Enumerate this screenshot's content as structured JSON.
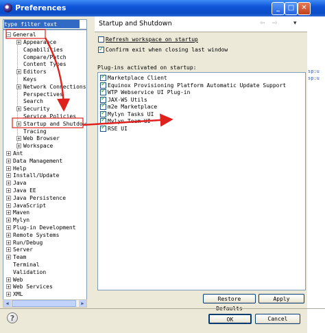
{
  "window": {
    "title": "Preferences"
  },
  "titlebar": {
    "minimize": "_",
    "maximize": "□",
    "close": "✕"
  },
  "filter": {
    "value": "type filter text"
  },
  "tree": {
    "general": {
      "label": "General",
      "children": [
        "Appearance",
        "Capabilities",
        "Compare/Patch",
        "Content Types",
        "Editors",
        "Keys",
        "Network Connections",
        "Perspectives",
        "Search",
        "Security",
        "Service Policies",
        "Startup and Shutdown",
        "Tracing",
        "Web Browser",
        "Workspace"
      ]
    },
    "roots": [
      "Ant",
      "Data Management",
      "Help",
      "Install/Update",
      "Java",
      "Java EE",
      "Java Persistence",
      "JavaScript",
      "Maven",
      "Mylyn",
      "Plug-in Development",
      "Remote Systems",
      "Run/Debug",
      "Server",
      "Team",
      "Terminal",
      "Validation",
      "Web",
      "Web Services",
      "XML"
    ]
  },
  "page": {
    "title": "Startup and Shutdown",
    "nav": {
      "back": "⇦",
      "forward": "⇨",
      "menu": "▾"
    },
    "refresh_label": "Refresh workspace on startup",
    "confirm_label": "Confirm exit when closing last window",
    "plugins_label": "Plug-ins activated on startup:",
    "plugins": [
      "Marketplace Client",
      "Equinox Provisioning Platform Automatic Update Support",
      "WTP Webservice UI Plug-in",
      "JAX-WS Utils",
      "m2e Marketplace",
      "Mylyn Tasks UI",
      "Mylyn Team UI",
      "RSE UI"
    ],
    "restore_defaults": "Restore Defaults",
    "apply": "Apply"
  },
  "buttons": {
    "ok": "OK",
    "cancel": "Cancel",
    "help": "?"
  },
  "background": {
    "snippets": [
      "sp:u",
      "sp:u"
    ]
  },
  "colors": {
    "selection": "#316ac5",
    "annotation": "#e0201c",
    "titlebar": "#0b4bc7"
  }
}
